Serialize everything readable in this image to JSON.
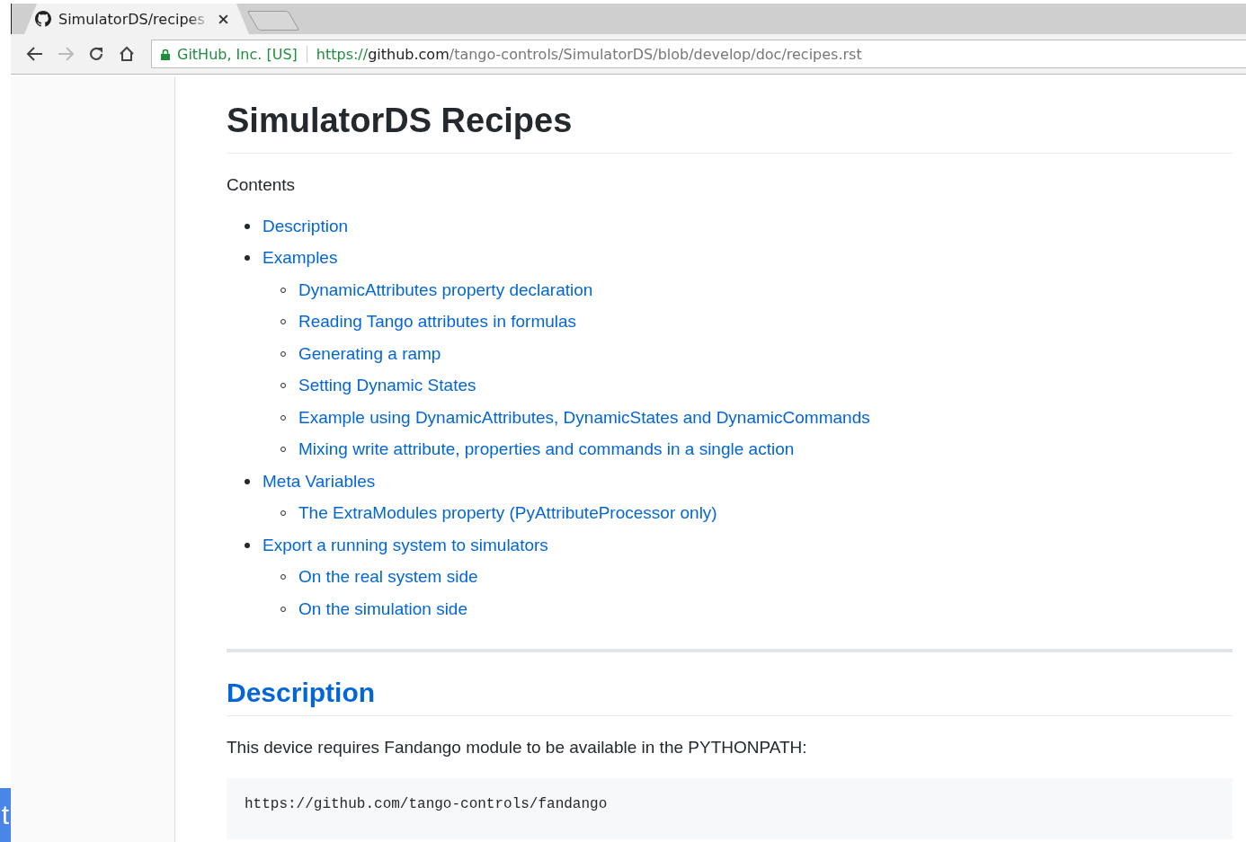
{
  "browser": {
    "tab": {
      "title": "SimulatorDS/recipes",
      "selected": true
    },
    "address": {
      "site_identity": "GitHub, Inc. [US]",
      "scheme": "https://",
      "host": "github.com",
      "path": "/tango-controls/SimulatorDS/blob/develop/doc/recipes.rst"
    }
  },
  "side_badge": "t",
  "page": {
    "title": "SimulatorDS Recipes",
    "contents_label": "Contents",
    "toc": [
      {
        "label": "Description"
      },
      {
        "label": "Examples",
        "children": [
          {
            "label": "DynamicAttributes property declaration"
          },
          {
            "label": "Reading Tango attributes in formulas"
          },
          {
            "label": "Generating a ramp"
          },
          {
            "label": "Setting Dynamic States"
          },
          {
            "label": "Example using DynamicAttributes, DynamicStates and DynamicCommands"
          },
          {
            "label": "Mixing write attribute, properties and commands in a single action"
          }
        ]
      },
      {
        "label": "Meta Variables",
        "children": [
          {
            "label": "The ExtraModules property (PyAttributeProcessor only)"
          }
        ]
      },
      {
        "label": "Export a running system to simulators",
        "children": [
          {
            "label": "On the real system side"
          },
          {
            "label": "On the simulation side"
          }
        ]
      }
    ],
    "section": {
      "heading": "Description",
      "paragraph": "This device requires Fandango module to be available in the PYTHONPATH:",
      "code": "https://github.com/tango-controls/fandango"
    }
  }
}
